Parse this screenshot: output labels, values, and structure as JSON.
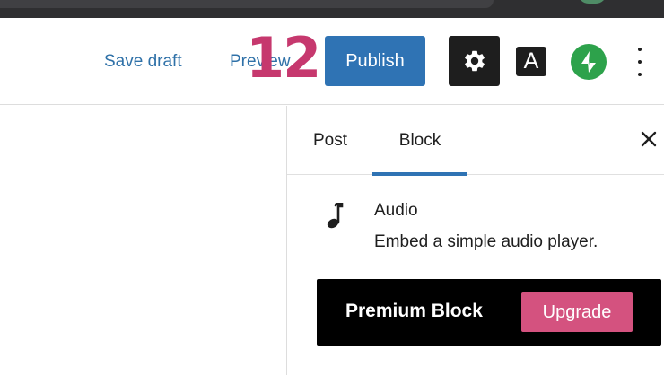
{
  "topbar": {
    "save_draft_label": "Save draft",
    "preview_label": "Preview",
    "step_number": "12",
    "publish_label": "Publish",
    "settings_icon": "gear-icon",
    "font_button_label": "A",
    "jetpack_icon": "jetpack-bolt-icon",
    "more_icon": "vertical-ellipsis-icon"
  },
  "sidebar": {
    "tabs": [
      {
        "label": "Post",
        "active": false
      },
      {
        "label": "Block",
        "active": true
      }
    ],
    "close_icon": "close-icon",
    "block": {
      "icon": "music-note-icon",
      "title": "Audio",
      "description": "Embed a simple audio player."
    },
    "premium": {
      "label": "Premium Block",
      "button_label": "Upgrade"
    }
  },
  "colors": {
    "accent_blue": "#2f73b4",
    "link_blue": "#2f71a8",
    "step_pink": "#c6386e",
    "upgrade_pink": "#d4527f",
    "jetpack_green": "#2da24b",
    "dark": "#1e1e1e"
  }
}
